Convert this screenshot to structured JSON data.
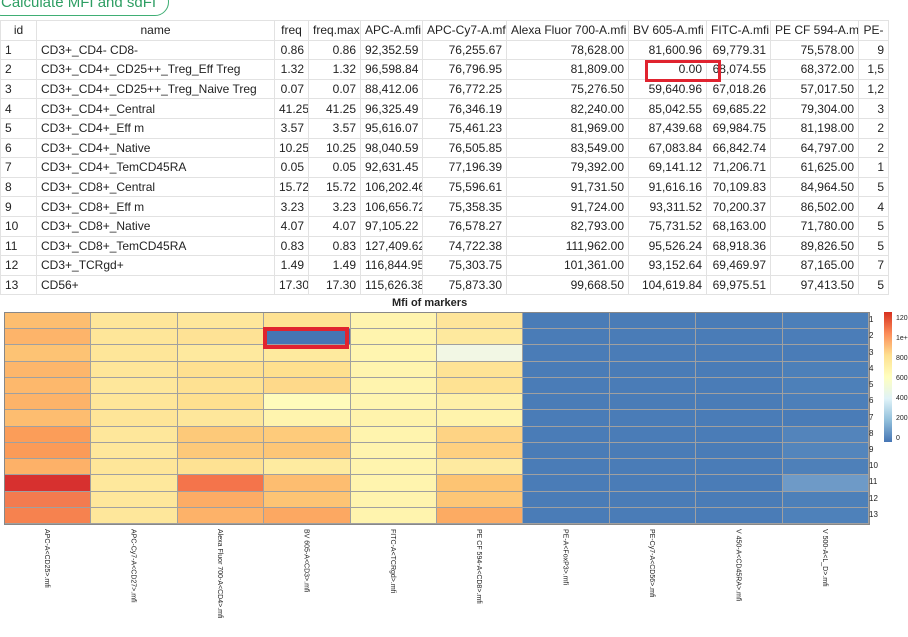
{
  "calc_button": "Calculate MFI and sdFI",
  "table": {
    "headers": [
      "id",
      "name",
      "freq",
      "freq.max",
      "APC-A.mfi",
      "APC-Cy7-A.mfi",
      "Alexa Fluor 700-A.mfi",
      "BV 605-A.mfi",
      "FITC-A.mfi",
      "PE CF 594-A.mfi",
      "PE-"
    ],
    "rows": [
      [
        "1",
        "CD3+_CD4- CD8-",
        "0.86",
        "0.86",
        "92,352.59",
        "76,255.67",
        "78,628.00",
        "81,600.96",
        "69,779.31",
        "75,578.00",
        "9"
      ],
      [
        "2",
        "CD3+_CD4+_CD25++_Treg_Eff Treg",
        "1.32",
        "1.32",
        "96,598.84",
        "76,796.95",
        "81,809.00",
        "0.00",
        "68,074.55",
        "68,372.00",
        "1,5"
      ],
      [
        "3",
        "CD3+_CD4+_CD25++_Treg_Naive Treg",
        "0.07",
        "0.07",
        "88,412.06",
        "76,772.25",
        "75,276.50",
        "59,640.96",
        "67,018.26",
        "57,017.50",
        "1,2"
      ],
      [
        "4",
        "CD3+_CD4+_Central",
        "41.25",
        "41.25",
        "96,325.49",
        "76,346.19",
        "82,240.00",
        "85,042.55",
        "69,685.22",
        "79,304.00",
        "3"
      ],
      [
        "5",
        "CD3+_CD4+_Eff m",
        "3.57",
        "3.57",
        "95,616.07",
        "75,461.23",
        "81,969.00",
        "87,439.68",
        "69,984.75",
        "81,198.00",
        "2"
      ],
      [
        "6",
        "CD3+_CD4+_Native",
        "10.25",
        "10.25",
        "98,040.59",
        "76,505.85",
        "83,549.00",
        "67,083.84",
        "66,842.74",
        "64,797.00",
        "2"
      ],
      [
        "7",
        "CD3+_CD4+_TemCD45RA",
        "0.05",
        "0.05",
        "92,631.45",
        "77,196.39",
        "79,392.00",
        "69,141.12",
        "71,206.71",
        "61,625.00",
        "1"
      ],
      [
        "8",
        "CD3+_CD8+_Central",
        "15.72",
        "15.72",
        "106,202.46",
        "75,596.61",
        "91,731.50",
        "91,616.16",
        "70,109.83",
        "84,964.50",
        "5"
      ],
      [
        "9",
        "CD3+_CD8+_Eff m",
        "3.23",
        "3.23",
        "106,656.72",
        "75,358.35",
        "91,724.00",
        "93,311.52",
        "70,200.37",
        "86,502.00",
        "4"
      ],
      [
        "10",
        "CD3+_CD8+_Native",
        "4.07",
        "4.07",
        "97,105.22",
        "76,578.27",
        "82,793.00",
        "75,731.52",
        "68,163.00",
        "71,780.00",
        "5"
      ],
      [
        "11",
        "CD3+_CD8+_TemCD45RA",
        "0.83",
        "0.83",
        "127,409.62",
        "74,722.38",
        "111,962.00",
        "95,526.24",
        "68,918.36",
        "89,826.50",
        "5"
      ],
      [
        "12",
        "CD3+_TCRgd+",
        "1.49",
        "1.49",
        "116,844.95",
        "75,303.75",
        "101,361.00",
        "93,152.64",
        "69,469.97",
        "87,165.00",
        "7"
      ],
      [
        "13",
        "CD56+",
        "17.30",
        "17.30",
        "115,626.38",
        "75,873.30",
        "99,668.50",
        "104,619.84",
        "69,975.51",
        "97,413.50",
        "5"
      ]
    ]
  },
  "heatmap": {
    "title": "Mfi of markers",
    "columns": [
      "APC-A<CD25>.mfi",
      "APC-Cy7-A<CD27>.mfi",
      "Alexa Fluor 700-A<CD4>.mfi",
      "BV 605-A<CD3>.mfi",
      "FITC-A<TCRgd>.mfi",
      "PE CF 594-A<CD8>.mfi",
      "PE-A<FoxP3>.mfi",
      "PE-Cy7-A<CD56>.mfi",
      "V 450-A<CD45RA>.mfi",
      "V 500-A<L_D>.mfi"
    ],
    "row_labels": [
      "1",
      "2",
      "3",
      "4",
      "5",
      "6",
      "7",
      "8",
      "9",
      "10",
      "11",
      "12",
      "13"
    ],
    "legend_ticks": [
      "120",
      "1e+",
      "800",
      "600",
      "400",
      "200",
      "0"
    ],
    "colors": [
      [
        "#fdbe70",
        "#fee699",
        "#fee79b",
        "#fee293",
        "#fff4ae",
        "#fee59a",
        "#4a7cb7",
        "#4a7cb7",
        "#4a7cb7",
        "#4c7fb9"
      ],
      [
        "#fdb46a",
        "#fee699",
        "#fee295",
        "#4575b4",
        "#fff4ae",
        "#fee99e",
        "#4a7cb7",
        "#4a7cb7",
        "#4a7cb7",
        "#4b7db8"
      ],
      [
        "#fdc374",
        "#fee699",
        "#fee99e",
        "#feea9e",
        "#fff5b0",
        "#f2f7e4",
        "#4a7cb7",
        "#4a7cb7",
        "#4a7cb7",
        "#4a7cb7"
      ],
      [
        "#fdb66b",
        "#fee699",
        "#fee090",
        "#fee08e",
        "#fff4ae",
        "#fee395",
        "#4a7cb7",
        "#4a7cb7",
        "#4a7cb7",
        "#4d80b9"
      ],
      [
        "#fdb86c",
        "#fee79b",
        "#fee192",
        "#fed98a",
        "#fff4ae",
        "#fee293",
        "#4a7cb7",
        "#4a7cb7",
        "#4a7cb7",
        "#4d80b9"
      ],
      [
        "#fdb369",
        "#fee699",
        "#fee08f",
        "#fffbbb",
        "#fff5b0",
        "#fef0a8",
        "#4a7cb7",
        "#4a7cb7",
        "#4a7cb7",
        "#4c7fb9"
      ],
      [
        "#fdbd70",
        "#fee598",
        "#fee79b",
        "#fff4ae",
        "#fff3ac",
        "#fff3ac",
        "#4a7cb7",
        "#4a7cb7",
        "#4a7cb7",
        "#4a7cb7"
      ],
      [
        "#fb9d59",
        "#fee79b",
        "#fdc979",
        "#fecb7b",
        "#fff4ae",
        "#fed384",
        "#4a7cb7",
        "#4a7cb7",
        "#4a7cb7",
        "#5384bb"
      ],
      [
        "#fb9b58",
        "#fee79b",
        "#fdc979",
        "#fdc676",
        "#fff4ae",
        "#fed080",
        "#4a7cb7",
        "#4a7cb7",
        "#4a7cb7",
        "#5385bc"
      ],
      [
        "#fdb168",
        "#fee699",
        "#fee293",
        "#feeba0",
        "#fff4ae",
        "#feeaa0",
        "#4a7cb7",
        "#4a7cb7",
        "#4a7cb7",
        "#4e80b9"
      ],
      [
        "#d7302f",
        "#fee89c",
        "#f4744b",
        "#fdbd70",
        "#fff4ae",
        "#fdc473",
        "#4a7cb7",
        "#4a7cb7",
        "#4a7cb7",
        "#6e9ac7"
      ],
      [
        "#f37b4f",
        "#fee79b",
        "#fdac65",
        "#fdc474",
        "#fff4ae",
        "#fdc676",
        "#4a7cb7",
        "#4a7cb7",
        "#4a7cb7",
        "#4d80b9"
      ],
      [
        "#f6824f",
        "#fee79b",
        "#fdb269",
        "#fca862",
        "#fff4ae",
        "#fcab63",
        "#4a7cb7",
        "#4a7cb7",
        "#4a7cb7",
        "#4e81ba"
      ]
    ]
  }
}
